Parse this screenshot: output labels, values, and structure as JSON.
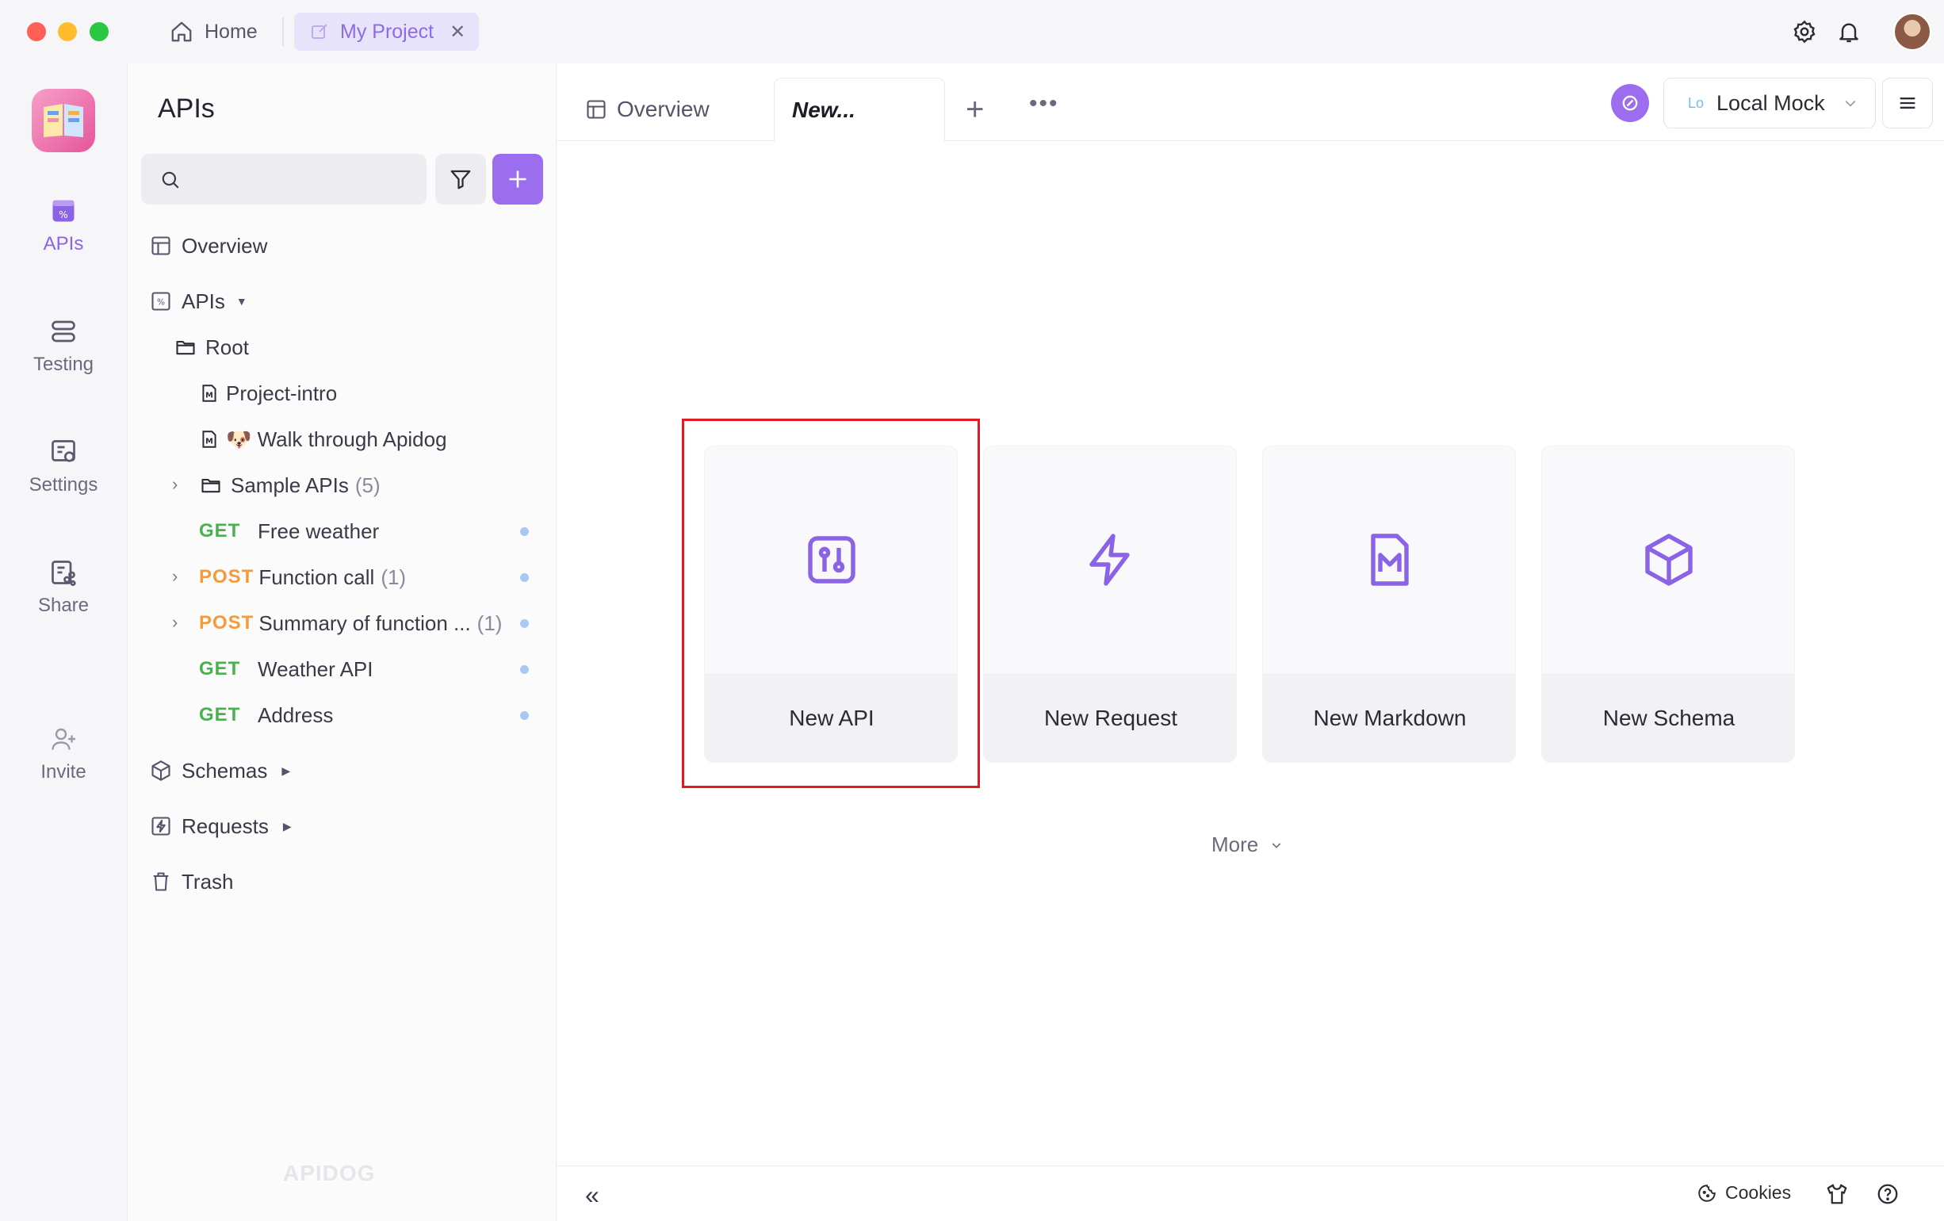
{
  "titlebar": {
    "home_label": "Home",
    "project_tab_label": "My Project",
    "close_glyph": "✕"
  },
  "rail": {
    "items": [
      {
        "label": "APIs",
        "icon": "api-icon",
        "active": true
      },
      {
        "label": "Testing",
        "icon": "testing-icon"
      },
      {
        "label": "Settings",
        "icon": "settings-icon"
      },
      {
        "label": "Share",
        "icon": "share-icon"
      },
      {
        "label": "Invite",
        "icon": "invite-icon"
      }
    ]
  },
  "sidebar": {
    "title": "APIs",
    "search_placeholder": "",
    "tree": {
      "overview": "Overview",
      "apis": "APIs",
      "root": "Root",
      "project_intro": "Project-intro",
      "walk_through": "🐶 Walk through Apidog",
      "sample_apis": "Sample APIs",
      "sample_apis_count": "(5)",
      "endpoints": [
        {
          "method": "GET",
          "name": "Free weather",
          "count": ""
        },
        {
          "method": "POST",
          "name": "Function call",
          "count": "(1)"
        },
        {
          "method": "POST",
          "name": "Summary of function ...",
          "count": "(1)"
        },
        {
          "method": "GET",
          "name": "Weather API",
          "count": ""
        },
        {
          "method": "GET",
          "name": "Address",
          "count": ""
        }
      ],
      "schemas": "Schemas",
      "requests": "Requests",
      "trash": "Trash"
    },
    "watermark": "APIDOG"
  },
  "main": {
    "tabs": [
      {
        "label": "Overview"
      },
      {
        "label": "New..."
      }
    ],
    "add_tab_glyph": "+",
    "more_tabs_glyph": "•••",
    "environment": {
      "badge": "Lo",
      "label": "Local Mock"
    },
    "cards": [
      {
        "label": "New API",
        "icon": "new-api-icon"
      },
      {
        "label": "New Request",
        "icon": "lightning-icon"
      },
      {
        "label": "New Markdown",
        "icon": "markdown-icon"
      },
      {
        "label": "New Schema",
        "icon": "cube-icon"
      }
    ],
    "more_label": "More",
    "footer": {
      "collapse_glyph": "«",
      "cookies_label": "Cookies"
    }
  },
  "colors": {
    "accent": "#9d6df0",
    "get": "#4caf50",
    "post": "#f39b3c",
    "highlight": "#e01b24"
  }
}
